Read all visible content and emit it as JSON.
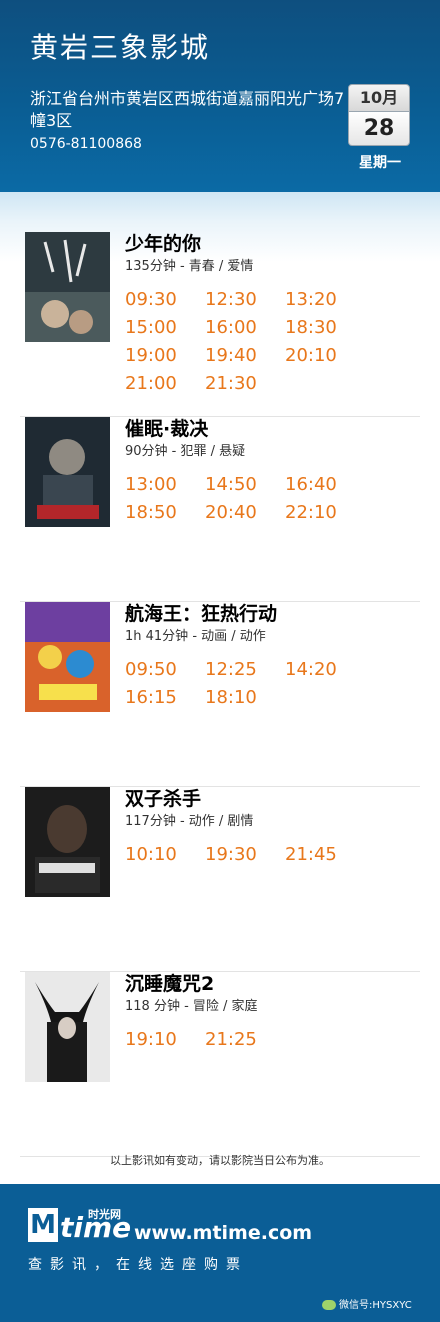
{
  "header": {
    "title": "黄岩三象影城",
    "address": "浙江省台州市黄岩区西城街道嘉丽阳光广场7幢3区",
    "phone": "0576-81100868",
    "date": {
      "month": "10月",
      "day": "28",
      "weekday": "星期一"
    }
  },
  "movies": [
    {
      "name": "少年的你",
      "meta": "135分钟 - 青春 / 爱情",
      "poster_icon": "movie-poster",
      "times": [
        "09:30",
        "12:30",
        "13:20",
        "15:00",
        "16:00",
        "18:30",
        "19:00",
        "19:40",
        "20:10",
        "21:00",
        "21:30"
      ]
    },
    {
      "name": "催眠·裁决",
      "meta": "90分钟 - 犯罪 / 悬疑",
      "poster_icon": "movie-poster",
      "times": [
        "13:00",
        "14:50",
        "16:40",
        "18:50",
        "20:40",
        "22:10"
      ]
    },
    {
      "name": "航海王：狂热行动",
      "meta": "1h 41分钟 - 动画 / 动作",
      "poster_icon": "movie-poster",
      "times": [
        "09:50",
        "12:25",
        "14:20",
        "16:15",
        "18:10"
      ]
    },
    {
      "name": "双子杀手",
      "meta": "117分钟 - 动作 / 剧情",
      "poster_icon": "movie-poster",
      "times": [
        "10:10",
        "19:30",
        "21:45"
      ]
    },
    {
      "name": "沉睡魔咒2",
      "meta": "118 分钟 - 冒险 / 家庭",
      "poster_icon": "movie-poster",
      "times": [
        "19:10",
        "21:25"
      ]
    }
  ],
  "notice": "以上影讯如有变动，请以影院当日公布为准。",
  "footer": {
    "logo_m": "M",
    "logo_time": "time",
    "logo_cn": "时光网",
    "site": "www.mtime.com",
    "slogan": "查影讯，在线选座购票",
    "wechat": "微信号:HYSXYC"
  },
  "colors": {
    "header_bg": "#0b5e96",
    "time_orange": "#e8771b"
  }
}
